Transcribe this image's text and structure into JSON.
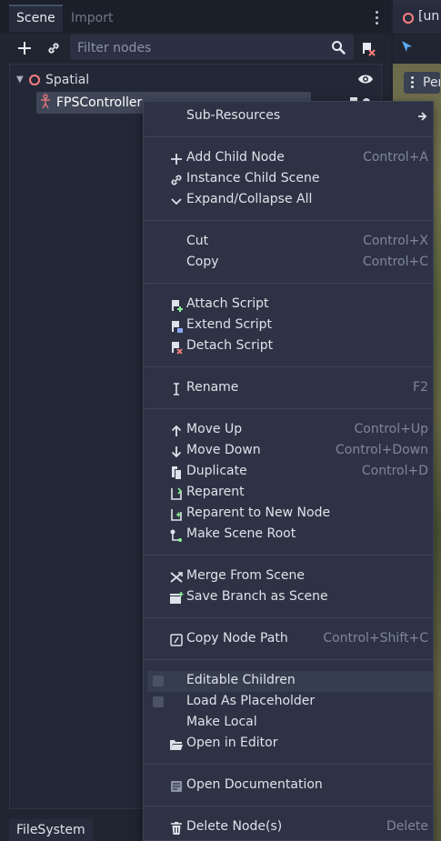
{
  "scene_dock": {
    "tabs": [
      {
        "label": "Scene"
      },
      {
        "label": "Import"
      }
    ],
    "filter_placeholder": "Filter nodes",
    "tree": [
      {
        "label": "Spatial"
      },
      {
        "label": "FPSController"
      }
    ],
    "bottom_tab": "FileSystem"
  },
  "viewport": {
    "tab_label": "[un",
    "view_button_label": "Per"
  },
  "context_menu": {
    "items": [
      {
        "label": "Sub-Resources",
        "shortcut": ""
      },
      {
        "label": "Add Child Node",
        "shortcut": "Control+A"
      },
      {
        "label": "Instance Child Scene",
        "shortcut": ""
      },
      {
        "label": "Expand/Collapse All",
        "shortcut": ""
      },
      {
        "label": "Cut",
        "shortcut": "Control+X"
      },
      {
        "label": "Copy",
        "shortcut": "Control+C"
      },
      {
        "label": "Attach Script",
        "shortcut": ""
      },
      {
        "label": "Extend Script",
        "shortcut": ""
      },
      {
        "label": "Detach Script",
        "shortcut": ""
      },
      {
        "label": "Rename",
        "shortcut": "F2"
      },
      {
        "label": "Move Up",
        "shortcut": "Control+Up"
      },
      {
        "label": "Move Down",
        "shortcut": "Control+Down"
      },
      {
        "label": "Duplicate",
        "shortcut": "Control+D"
      },
      {
        "label": "Reparent",
        "shortcut": ""
      },
      {
        "label": "Reparent to New Node",
        "shortcut": ""
      },
      {
        "label": "Make Scene Root",
        "shortcut": ""
      },
      {
        "label": "Merge From Scene",
        "shortcut": ""
      },
      {
        "label": "Save Branch as Scene",
        "shortcut": ""
      },
      {
        "label": "Copy Node Path",
        "shortcut": "Control+Shift+C"
      },
      {
        "label": "Editable Children",
        "shortcut": "",
        "checked": false
      },
      {
        "label": "Load As Placeholder",
        "shortcut": "",
        "checked": false
      },
      {
        "label": "Make Local",
        "shortcut": ""
      },
      {
        "label": "Open in Editor",
        "shortcut": ""
      },
      {
        "label": "Open Documentation",
        "shortcut": ""
      },
      {
        "label": "Delete Node(s)",
        "shortcut": "Delete"
      }
    ]
  },
  "colors": {
    "accent_green": "#8eef97",
    "node_red": "#fc7f7f",
    "selection": "#3f4658",
    "menu_bg": "#2d3344"
  }
}
